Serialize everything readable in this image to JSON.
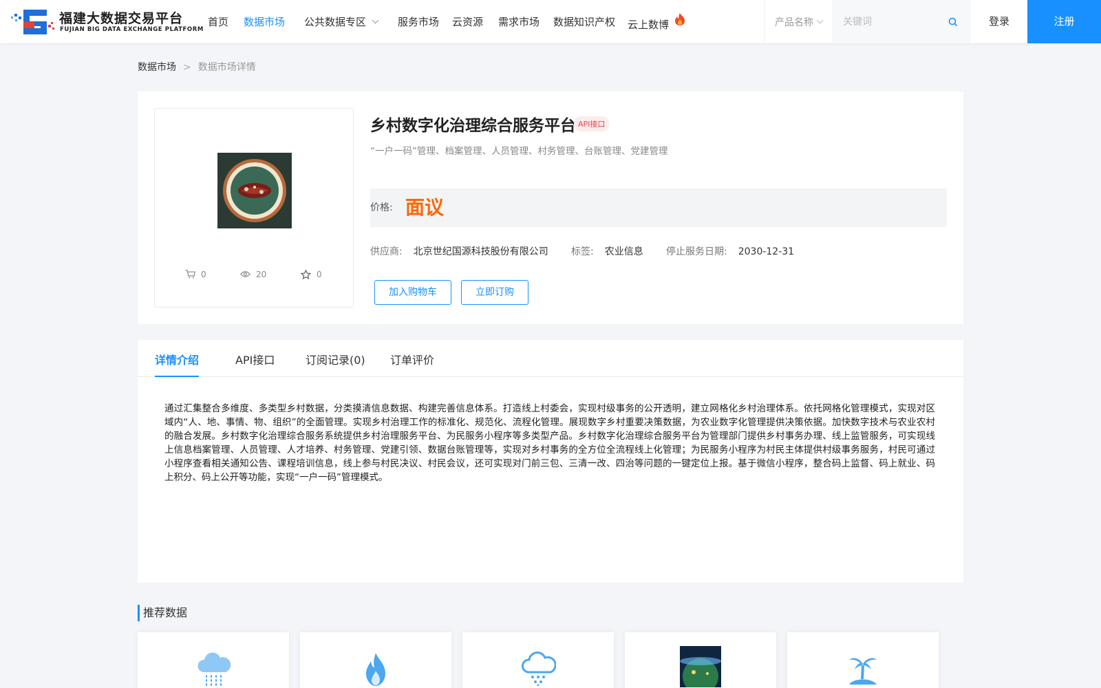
{
  "header": {
    "logo_cn": "福建大数据交易平台",
    "logo_en": "FUJIAN BIG DATA EXCHANGE  PLATFORM",
    "nav": [
      {
        "label": "首页",
        "active": false
      },
      {
        "label": "数据市场",
        "active": true
      },
      {
        "label": "公共数据专区",
        "active": false,
        "dropdown": true
      },
      {
        "label": "服务市场",
        "active": false
      },
      {
        "label": "云资源",
        "active": false
      },
      {
        "label": "需求市场",
        "active": false
      },
      {
        "label": "数据知识产权",
        "active": false
      },
      {
        "label": "云上数博",
        "active": false,
        "icon": "fire-icon"
      }
    ],
    "search": {
      "type_label": "产品名称",
      "placeholder": "关键词",
      "value": ""
    },
    "login_label": "登录",
    "register_label": "注册"
  },
  "breadcrumb": {
    "home": "数据市场",
    "separator": ">",
    "current": "数据市场详情"
  },
  "product": {
    "title": "乡村数字化治理综合服务平台",
    "badge": "API接口",
    "subtitle": "“一户一码”管理、档案管理、人员管理、村务管理、台账管理、党建管理",
    "price_label": "价格:",
    "price_value": "面议",
    "stats": {
      "cart_count": "0",
      "view_count": "20",
      "favorite_count": "0"
    },
    "meta": {
      "supplier_label": "供应商:",
      "supplier_value": "北京世纪国源科技股份有限公司",
      "tag_label": "标签:",
      "tag_value": "农业信息",
      "stop_label": "停止服务日期:",
      "stop_value": "2030-12-31"
    },
    "add_cart_label": "加入购物车",
    "buy_label": "立即订购"
  },
  "detail": {
    "tabs": [
      {
        "label": "详情介绍",
        "active": true
      },
      {
        "label": "API接口",
        "active": false
      },
      {
        "label": "订阅记录(0)",
        "active": false
      },
      {
        "label": "订单评价",
        "active": false
      }
    ],
    "description": "通过汇集整合多维度、多类型乡村数据，分类摸清信息数据、构建完善信息体系。打造线上村委会，实现村级事务的公开透明，建立网格化乡村治理体系。依托网格化管理模式，实现对区域内“人、地、事情、物、组织”的全面管理。实现乡村治理工作的标准化、规范化、流程化管理。展现数字乡村重要决策数据，为农业数字化管理提供决策依据。加快数字技术与农业农村的融合发展。乡村数字化治理综合服务系统提供乡村治理服务平台、为民服务小程序等多类型产品。乡村数字化治理综合服务平台为管理部门提供乡村事务办理、线上监管服务，可实现线上信息档案管理、人员管理、人才培养、村务管理、党建引领、数据台账管理等，实现对乡村事务的全方位全流程线上化管理；为民服务小程序为村民主体提供村级事务服务，村民可通过小程序查看相关通知公告、课程培训信息，线上参与村民决议、村民会议，还可实现对门前三包、三清一改、四治等问题的一键定位上报。基于微信小程序，整合码上监督、码上就业、码上积分、码上公开等功能，实现“一户一码”管理模式。"
  },
  "recommend": {
    "title": "推荐数据",
    "items": [
      {
        "icon": "rain-cloud-icon"
      },
      {
        "icon": "flame-icon"
      },
      {
        "icon": "snow-cloud-icon"
      },
      {
        "icon": "earth-image-icon"
      },
      {
        "icon": "island-icon"
      }
    ]
  },
  "colors": {
    "primary": "#1890ff",
    "price": "#ff6600",
    "badge_text": "#e84646",
    "badge_bg": "#fdecec",
    "icon_blue": "#4aa7f0"
  }
}
